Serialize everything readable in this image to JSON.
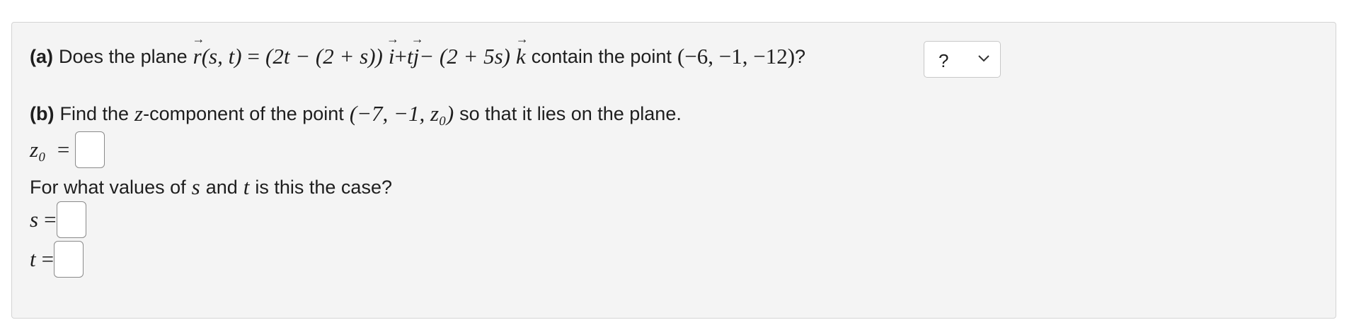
{
  "part_a": {
    "label": "(a)",
    "text_before": "Does the plane",
    "r": "r",
    "args": "(s, t)",
    "eq": "=",
    "expr1": "(2t − (2 + s))",
    "i": "i",
    "plus": "+",
    "t": "t",
    "j": "j",
    "expr2": "− (2 + 5s)",
    "k": "k",
    "text_after": "contain the point",
    "point": "(−6, −1, −12)",
    "qmark": "?",
    "select_value": "?"
  },
  "part_b": {
    "label": "(b)",
    "text1": "Find the",
    "z": "z",
    "text2": "-component of the point",
    "point": "(−7, −1, z₀)",
    "text3": "so that it lies on the plane.",
    "z0_label": "z₀",
    "eq": "=",
    "question": "For what values of",
    "s": "s",
    "and": "and",
    "t": "t",
    "question_end": "is this the case?",
    "s_label": "s",
    "t_label": "t"
  }
}
